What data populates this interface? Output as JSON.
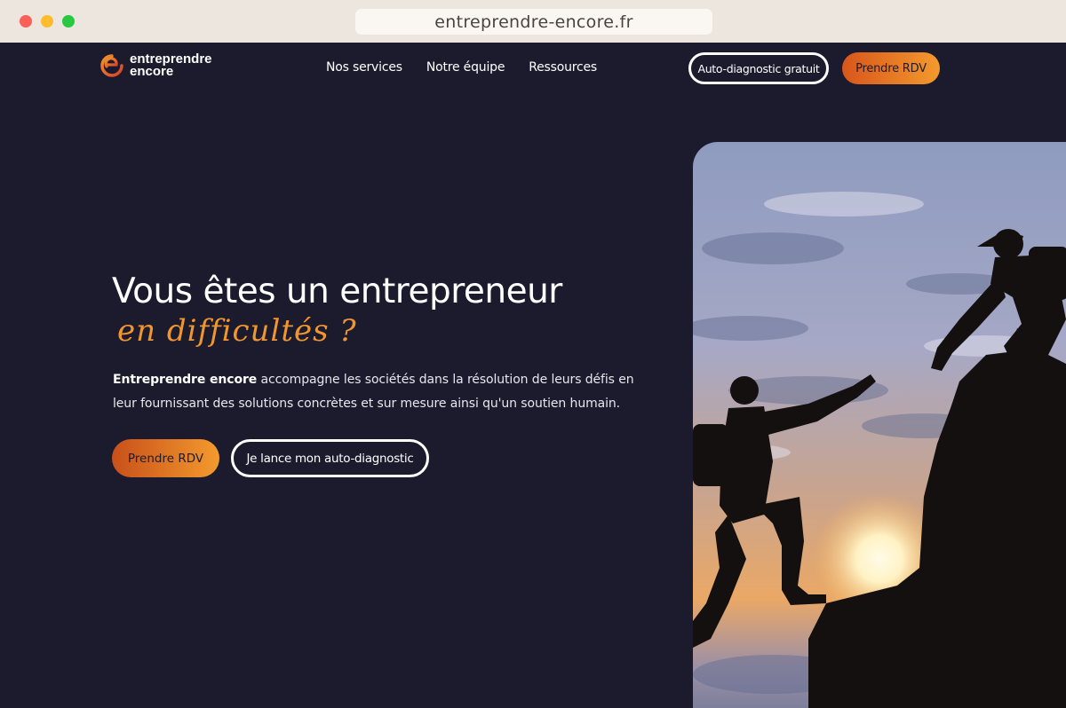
{
  "browser": {
    "url": "entreprendre-encore.fr"
  },
  "nav": {
    "logo_line1": "entreprendre",
    "logo_line2": "encore",
    "links": [
      "Nos services",
      "Notre équipe",
      "Ressources"
    ],
    "cta_outline": "Auto-diagnostic gratuit",
    "cta_primary": "Prendre RDV"
  },
  "hero": {
    "title": "Vous êtes un entrepreneur",
    "subtitle": "en difficultés ?",
    "text_bold": "Entreprendre encore",
    "text_rest": " accompagne les sociétés dans la résolution de leurs défis en leur fournissant des solutions concrètes et sur mesure ainsi qu'un soutien humain.",
    "btn_primary": "Prendre RDV",
    "btn_secondary": "Je lance mon auto-diagnostic"
  },
  "colors": {
    "background": "#1c1b2e",
    "accent": "#f0962d",
    "accent_dark": "#d8561b"
  },
  "image": {
    "icon": "climbers-silhouette-image"
  }
}
